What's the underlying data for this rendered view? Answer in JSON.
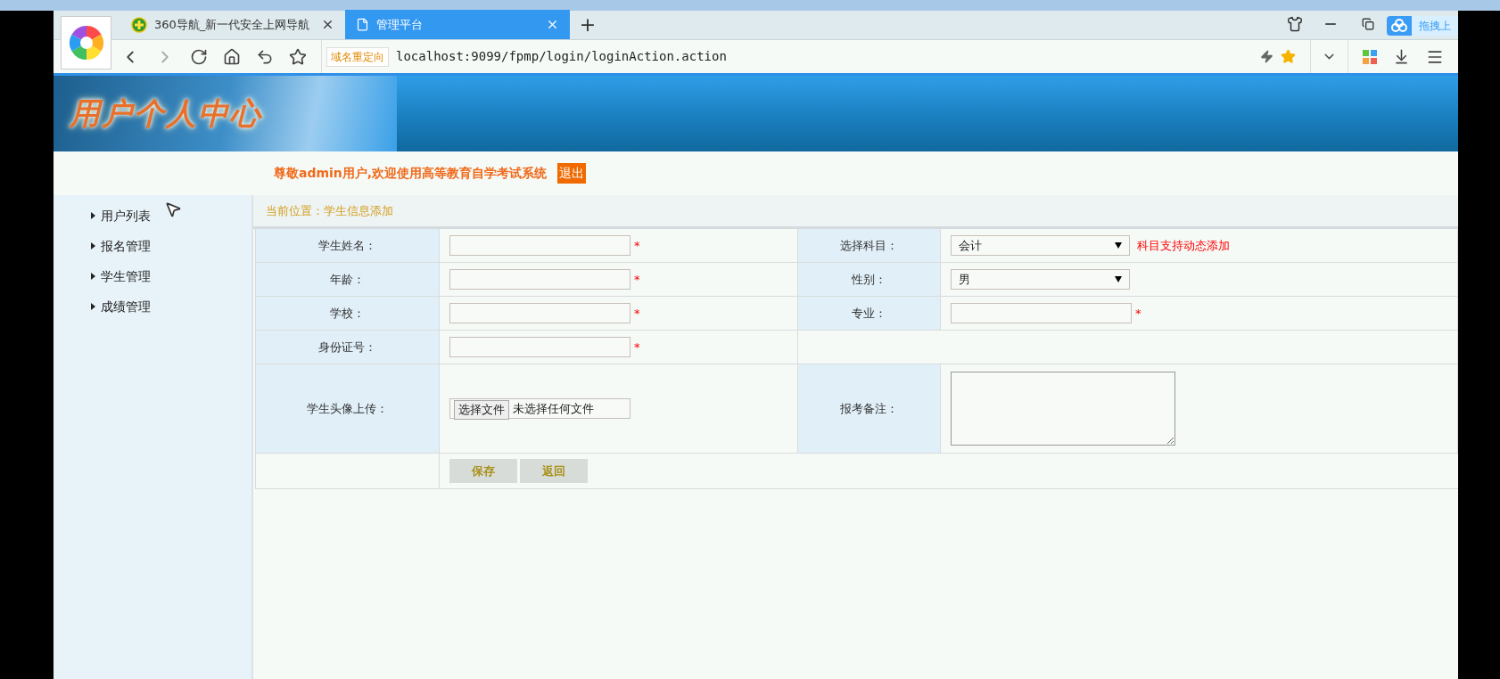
{
  "browser": {
    "tabs": [
      {
        "label": "360导航_新一代安全上网导航",
        "kind": "site",
        "selected": false
      },
      {
        "label": "管理平台",
        "kind": "page",
        "selected": true
      }
    ],
    "new_tab": "+",
    "redirect_badge": "域名重定向",
    "url": "localhost:9099/fpmp/login/loginAction.action",
    "upload_button": "拖拽上"
  },
  "header": {
    "logo_text": "用户个人中心",
    "welcome": "尊敬admin用户,欢迎使用高等教育自学考试系统",
    "logout": "退出"
  },
  "sidebar": {
    "items": [
      {
        "label": "用户列表"
      },
      {
        "label": "报名管理"
      },
      {
        "label": "学生管理"
      },
      {
        "label": "成绩管理"
      }
    ]
  },
  "breadcrumb": "当前位置：学生信息添加",
  "form": {
    "rows": [
      {
        "left": {
          "label": "学生姓名：",
          "kind": "text",
          "mark": "*"
        },
        "right": {
          "label": "选择科目：",
          "kind": "select",
          "value": "会计",
          "note": "科目支持动态添加"
        }
      },
      {
        "left": {
          "label": "年龄：",
          "kind": "text",
          "mark": "*"
        },
        "right": {
          "label": "性别：",
          "kind": "select",
          "value": "男"
        }
      },
      {
        "left": {
          "label": "学校：",
          "kind": "text",
          "mark": "*"
        },
        "right": {
          "label": "专业：",
          "kind": "text",
          "mark": "*"
        }
      },
      {
        "left": {
          "label": "身份证号：",
          "kind": "text",
          "mark": "*"
        }
      },
      {
        "left": {
          "label": "学生头像上传：",
          "kind": "file",
          "button": "选择文件",
          "status": "未选择任何文件"
        },
        "right": {
          "label": "报考备注：",
          "kind": "textarea"
        }
      }
    ],
    "buttons": [
      "保存",
      "返回"
    ]
  }
}
